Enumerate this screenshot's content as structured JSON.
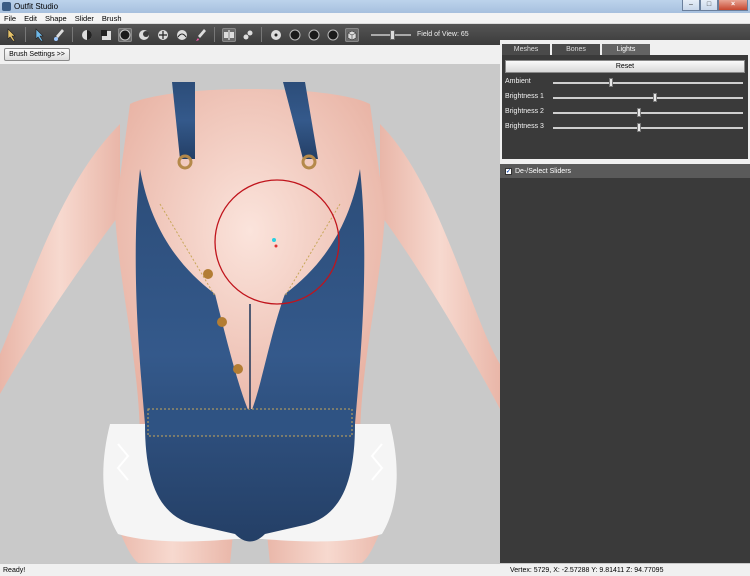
{
  "window": {
    "title": "Outfit Studio"
  },
  "menu": [
    "File",
    "Edit",
    "Shape",
    "Slider",
    "Brush"
  ],
  "toolbar": {
    "fov_label": "Field of View: 65",
    "fov_level": 0.5
  },
  "brush_settings_label": "Brush Settings >>",
  "tabs": [
    "Meshes",
    "Bones",
    "Lights"
  ],
  "selected_tab": "Lights",
  "lights": {
    "reset_label": "Reset",
    "rows": [
      {
        "label": "Ambient",
        "level": 0.3
      },
      {
        "label": "Brightness 1",
        "level": 0.54
      },
      {
        "label": "Brightness 2",
        "level": 0.45
      },
      {
        "label": "Brightness 3",
        "level": 0.45
      }
    ]
  },
  "sliders_header": "De-/Select Sliders",
  "status": {
    "left": "Ready!",
    "vertex": "Vertex: 5729, X: -2.57288 Y: 9.81411 Z: 94.77095"
  },
  "colors": {
    "viewport_bg": "#c9c9c9",
    "denim": "#2d4f7c",
    "brush_circle": "#c0141c",
    "panel_dark": "#3a3a3a"
  }
}
